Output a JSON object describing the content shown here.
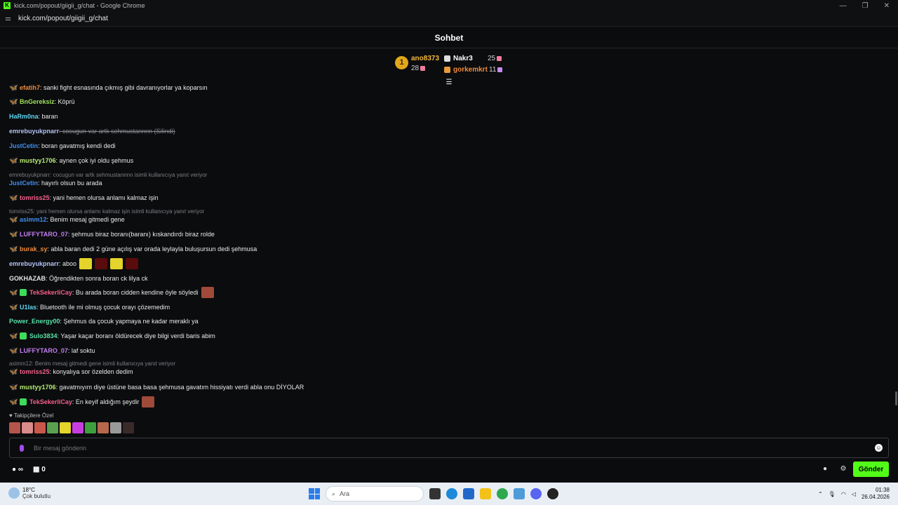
{
  "browser": {
    "window_title": "kick.com/popout/giigii_g/chat - Google Chrome",
    "url": "kick.com/popout/giigii_g/chat"
  },
  "chat": {
    "title": "Sohbet"
  },
  "leaderboard": {
    "first": {
      "rank": "1",
      "name": "ano8373",
      "count": "28"
    },
    "others": [
      {
        "name": "Nakr3",
        "count": "25"
      },
      {
        "name": "gorkemkrt",
        "count": "11"
      }
    ]
  },
  "messages": [
    {
      "user": "efatih7",
      "text": ": sanki fight esnasında çıkmış gibi davranıyorlar ya koparsın",
      "color": "#ee8a3b",
      "badge": "sub-o"
    },
    {
      "user": "BnGereksiz",
      "text": ": Köprü",
      "color": "#9ee45a",
      "badge": "sub-y"
    },
    {
      "user": "HaRm0na",
      "text": ": baran",
      "color": "#5dd6f3",
      "badge": ""
    },
    {
      "user": "emrebuyukpnarr",
      "text": ": cocugun var artk sehmustannnn (Silindi)",
      "color": "#b3c2f3",
      "badge": "",
      "deleted": true
    },
    {
      "user": "JustCetin",
      "text": ": boran gavatmış kendi dedi",
      "color": "#3f8ff1",
      "badge": ""
    },
    {
      "user": "mustyy1706",
      "text": ": aynen çok iyi oldu şehmus",
      "color": "#b6ec73",
      "badge": "sub-y"
    },
    {
      "reply": "emrebuyukpnarr: cocugun var artk sehmustannnn isimli kullanıcıya yanıt veriyor"
    },
    {
      "user": "JustCetin",
      "text": ": hayırlı olsun bu arada",
      "color": "#3f8ff1",
      "badge": ""
    },
    {
      "user": "tomriss25",
      "text": ": yani hemen olursa anlamı kalmaz işin",
      "color": "#f4608b",
      "badge": "sub-y"
    },
    {
      "reply": "tomriss25: yani hemen olursa anlamı kalmaz işin isimli kullanıcıya yanıt veriyor"
    },
    {
      "user": "asimm12",
      "text": ": Benim mesaj gitmedi gene",
      "color": "#3f8ff1",
      "badge": "sub-y"
    },
    {
      "user": "LUFFYTARO_07",
      "text": ": şehmus biraz boranı(baranı) kıskandırdı biraz rolde",
      "color": "#c27ef1",
      "badge": "sub-p"
    },
    {
      "user": "burak_sy",
      "text": ": abla baran dedi 2 güne açılış var orada leylayla buluşursun dedi şehmusa",
      "color": "#ee8a3b",
      "badge": "sub-p"
    },
    {
      "user": "emrebuyukpnarr",
      "text": ": aboo",
      "color": "#b3c2f3",
      "badge": "",
      "emotes": [
        "#e4d42b",
        "#5a0b0b",
        "#e4d42b",
        "#5a0b0b"
      ]
    },
    {
      "user": "GOKHAZAB",
      "text": ": Öğrendikten sonra boran ck lilya ck",
      "color": "#e6e6e6",
      "badge": ""
    },
    {
      "user": "TekSekerliCay",
      "text": ": Bu arada boran cidden kendine öyle söyledi",
      "color": "#f4608b",
      "badge": "sub-p",
      "gift": true,
      "emotes": [
        "#a04a3a"
      ]
    },
    {
      "user": "U1las",
      "text": ": Bluetooth ile mi olmuş çocuk orayı çözemedim",
      "color": "#5dd6f3",
      "badge": "sub-p"
    },
    {
      "user": "Power_Energy00",
      "text": ": Şehmus da çocuk yapmaya ne kadar meraklı ya",
      "color": "#58e0a6",
      "badge": ""
    },
    {
      "user": "Sulo3834",
      "text": ": Yaşar kaçar boranı öldürecek diye bilgi verdi baris abim",
      "color": "#58e0a6",
      "badge": "sub-p",
      "gift": true
    },
    {
      "user": "LUFFYTARO_07",
      "text": ": laf soktu",
      "color": "#c27ef1",
      "badge": "sub-p"
    },
    {
      "reply": "asimm12: Benim mesaj gitmedi gene isimli kullanıcıya yanıt veriyor"
    },
    {
      "user": "tomriss25",
      "text": ": konyalıya sor özelden dedim",
      "color": "#f4608b",
      "badge": "sub-y"
    },
    {
      "user": "mustyy1706",
      "text": ": gavatmıyım diye üstüne basa basa şehmusa gavatım hissiyatı verdi abla onu DİYOLAR",
      "color": "#b6ec73",
      "badge": "sub-p"
    },
    {
      "user": "TekSekerliCay",
      "text": ": En keyif aldığım şeydir",
      "color": "#f4608b",
      "badge": "sub-p",
      "gift": true,
      "emotes": [
        "#a04a3a"
      ]
    }
  ],
  "followers_only": {
    "label": "Takipçilere Özel",
    "emote_colors": [
      "#b5544a",
      "#d98a8a",
      "#c9584a",
      "#5aa050",
      "#e4d42b",
      "#c63ee0",
      "#3f9f3f",
      "#b8684a",
      "#9a9a9a",
      "#3a2a2a"
    ]
  },
  "composer": {
    "placeholder": "Bir mesaj gönderin",
    "send_label": "Gönder",
    "points": "0",
    "infinity": "∞"
  },
  "taskbar": {
    "temperature": "18°C",
    "weather": "Çok bulutlu",
    "search_label": "Ara",
    "time": "01:38",
    "date": "26.04.2026"
  }
}
